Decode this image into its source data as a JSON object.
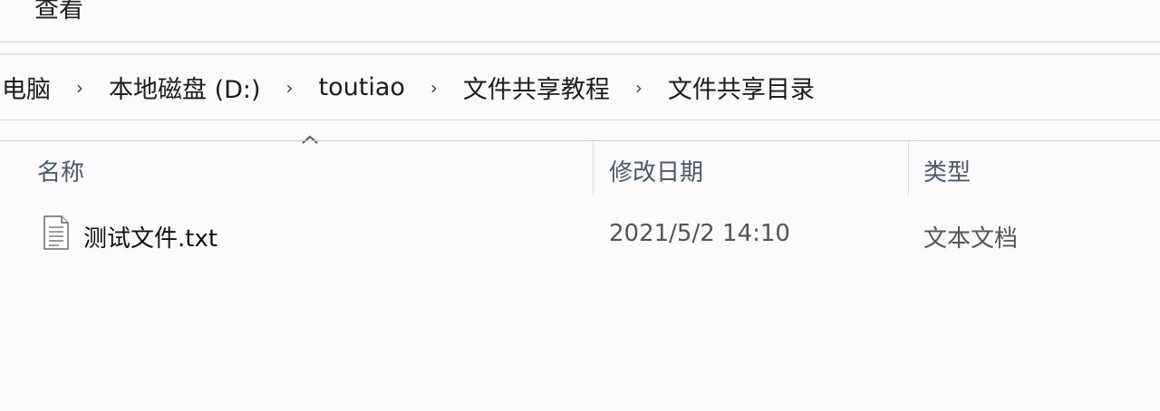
{
  "menu": {
    "view_label": "查看"
  },
  "breadcrumb": {
    "items": [
      "电脑",
      "本地磁盘 (D:)",
      "toutiao",
      "文件共享教程",
      "文件共享目录"
    ],
    "separator": "›"
  },
  "columns": {
    "name": "名称",
    "modified": "修改日期",
    "type": "类型"
  },
  "files": [
    {
      "name": "测试文件.txt",
      "modified": "2021/5/2 14:10",
      "type": "文本文档",
      "icon": "text-file-icon"
    }
  ],
  "colors": {
    "header_text": "#4a5a6e",
    "background": "#fcfafc"
  }
}
